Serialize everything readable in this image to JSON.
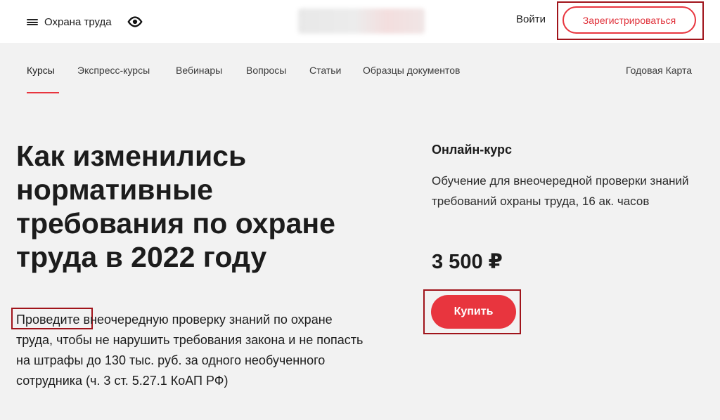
{
  "header": {
    "menu_label": "Охрана труда",
    "eye_icon": "eye-icon",
    "login_label": "Войти",
    "register_label": "Зарегистрироваться"
  },
  "nav": {
    "items": [
      {
        "label": "Курсы",
        "active": true
      },
      {
        "label": "Экспресс-курсы",
        "active": false
      },
      {
        "label": "Вебинары",
        "active": false
      },
      {
        "label": "Вопросы",
        "active": false
      },
      {
        "label": "Статьи",
        "active": false
      },
      {
        "label": "Образцы документов",
        "active": false
      }
    ],
    "right_label": "Годовая Карта"
  },
  "main": {
    "headline": "Как изменились нормативные требования по охране труда в 2022 году",
    "desc_highlight": "Проведите",
    "desc_rest": " внеочередную проверку знаний по охране труда, чтобы не нарушить требования закона и не попасть на штрафы до 130 тыс. руб. за одного необученного сотрудника (ч. 3 ст. 5.27.1 КоАП РФ)"
  },
  "course_card": {
    "type": "Онлайн-курс",
    "description": "Обучение для внеочередной проверки знаний требований охраны труда, 16 ак. часов",
    "price": "3 500 ₽",
    "buy_label": "Купить"
  },
  "colors": {
    "accent": "#e8353e",
    "highlight_frame": "#a0141b",
    "background": "#f2f2f2",
    "header_bg": "#ffffff"
  }
}
